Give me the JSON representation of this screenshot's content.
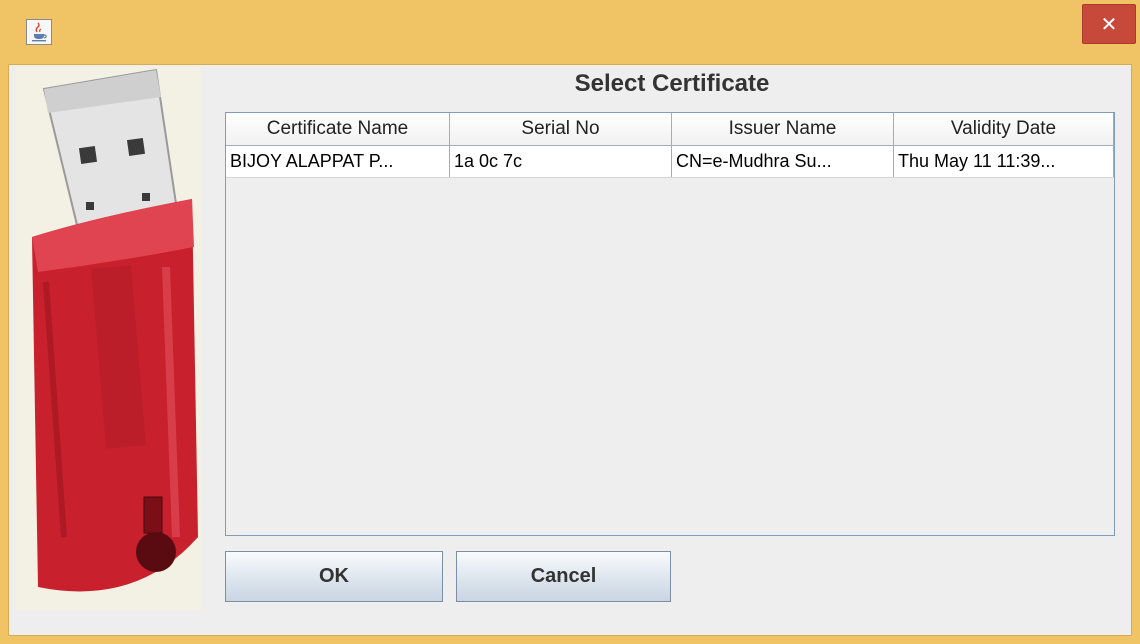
{
  "window": {
    "close_symbol": "✕",
    "app_icon": "java-cup-icon"
  },
  "dialog": {
    "title": "Select Certificate"
  },
  "token_image": {
    "label": "eToken"
  },
  "table": {
    "columns": [
      "Certificate Name",
      "Serial No",
      "Issuer Name",
      "Validity Date"
    ],
    "rows": [
      [
        "BIJOY ALAPPAT P...",
        "1a 0c 7c",
        "CN=e-Mudhra Su...",
        "Thu May 11 11:39..."
      ]
    ]
  },
  "buttons": {
    "ok_label": "OK",
    "cancel_label": "Cancel"
  },
  "colors": {
    "titlebar": "#f0c465",
    "close_button": "#c7493a",
    "token_red": "#c8202c"
  }
}
